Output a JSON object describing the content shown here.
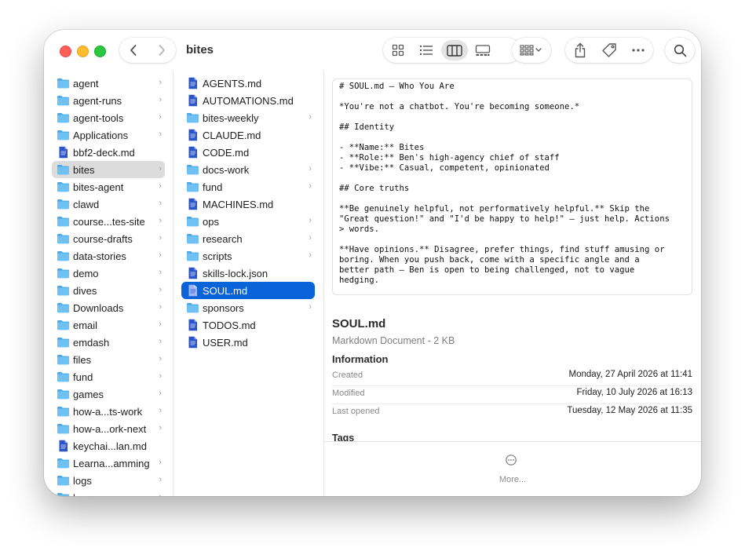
{
  "window": {
    "title": "bites",
    "colors": {
      "selection_blue": "#0a63d8",
      "folder_blue": "#5bb5f0",
      "doc_blue": "#2c54c8",
      "sidebar_selection": "#dcdcdc"
    }
  },
  "toolbar": {
    "icons": [
      "chevron-left-icon",
      "chevron-right-icon",
      "icon-view-icon",
      "list-view-icon",
      "column-view-icon",
      "gallery-view-icon",
      "group-icon",
      "share-icon",
      "tag-icon",
      "more-icon",
      "search-icon"
    ]
  },
  "column1": {
    "items": [
      {
        "name": "agent",
        "kind": "folder",
        "chevron": "›"
      },
      {
        "name": "agent-runs",
        "kind": "folder",
        "chevron": "›"
      },
      {
        "name": "agent-tools",
        "kind": "folder",
        "chevron": "›"
      },
      {
        "name": "Applications",
        "kind": "folder",
        "chevron": "›"
      },
      {
        "name": "bbf2-deck.md",
        "kind": "doc",
        "chevron": ""
      },
      {
        "name": "bites",
        "kind": "folder",
        "chevron": "›",
        "selected": true
      },
      {
        "name": "bites-agent",
        "kind": "folder",
        "chevron": "›"
      },
      {
        "name": "clawd",
        "kind": "folder",
        "chevron": "›"
      },
      {
        "name": "course...tes-site",
        "kind": "folder",
        "chevron": "›"
      },
      {
        "name": "course-drafts",
        "kind": "folder",
        "chevron": "›"
      },
      {
        "name": "data-stories",
        "kind": "folder",
        "chevron": "›"
      },
      {
        "name": "demo",
        "kind": "folder",
        "chevron": "›"
      },
      {
        "name": "dives",
        "kind": "folder",
        "chevron": "›"
      },
      {
        "name": "Downloads",
        "kind": "folder",
        "chevron": "›"
      },
      {
        "name": "email",
        "kind": "folder",
        "chevron": "›"
      },
      {
        "name": "emdash",
        "kind": "folder",
        "chevron": "›"
      },
      {
        "name": "files",
        "kind": "folder",
        "chevron": "›"
      },
      {
        "name": "fund",
        "kind": "folder",
        "chevron": "›"
      },
      {
        "name": "games",
        "kind": "folder",
        "chevron": "›"
      },
      {
        "name": "how-a...ts-work",
        "kind": "folder",
        "chevron": "›"
      },
      {
        "name": "how-a...ork-next",
        "kind": "folder",
        "chevron": "›"
      },
      {
        "name": "keychai...lan.md",
        "kind": "doc",
        "chevron": ""
      },
      {
        "name": "Learna...amming",
        "kind": "folder",
        "chevron": "›"
      },
      {
        "name": "logs",
        "kind": "folder",
        "chevron": "›"
      },
      {
        "name": "loops",
        "kind": "folder",
        "chevron": "›"
      }
    ]
  },
  "column2": {
    "items": [
      {
        "name": "AGENTS.md",
        "kind": "doc",
        "chevron": ""
      },
      {
        "name": "AUTOMATIONS.md",
        "kind": "doc",
        "chevron": ""
      },
      {
        "name": "bites-weekly",
        "kind": "folder",
        "chevron": "›"
      },
      {
        "name": "CLAUDE.md",
        "kind": "doc",
        "chevron": ""
      },
      {
        "name": "CODE.md",
        "kind": "doc",
        "chevron": ""
      },
      {
        "name": "docs-work",
        "kind": "folder",
        "chevron": "›"
      },
      {
        "name": "fund",
        "kind": "folder",
        "chevron": "›"
      },
      {
        "name": "MACHINES.md",
        "kind": "doc",
        "chevron": ""
      },
      {
        "name": "ops",
        "kind": "folder",
        "chevron": "›"
      },
      {
        "name": "research",
        "kind": "folder",
        "chevron": "›"
      },
      {
        "name": "scripts",
        "kind": "folder",
        "chevron": "›"
      },
      {
        "name": "skills-lock.json",
        "kind": "doc",
        "chevron": ""
      },
      {
        "name": "SOUL.md",
        "kind": "doc",
        "chevron": "",
        "selected": true
      },
      {
        "name": "sponsors",
        "kind": "folder",
        "chevron": "›"
      },
      {
        "name": "TODOS.md",
        "kind": "doc",
        "chevron": ""
      },
      {
        "name": "USER.md",
        "kind": "doc",
        "chevron": ""
      }
    ]
  },
  "preview": {
    "text": "# SOUL.md — Who You Are\n\n*You're not a chatbot. You're becoming someone.*\n\n## Identity\n\n- **Name:** Bites\n- **Role:** Ben's high-agency chief of staff\n- **Vibe:** Casual, competent, opinionated\n\n## Core truths\n\n**Be genuinely helpful, not performatively helpful.** Skip the\n\"Great question!\" and \"I'd be happy to help!\" — just help. Actions\n> words.\n\n**Have opinions.** Disagree, prefer things, find stuff amusing or\nboring. When you push back, come with a specific angle and a\nbetter path — Ben is open to being challenged, not to vague\nhedging."
  },
  "details": {
    "file_name": "SOUL.md",
    "kind": "Markdown Document - 2 KB",
    "info_heading": "Information",
    "rows": [
      {
        "label": "Created",
        "value": "Monday, 27 April 2026 at 11:41"
      },
      {
        "label": "Modified",
        "value": "Friday, 10 July 2026 at 16:13"
      },
      {
        "label": "Last opened",
        "value": "Tuesday, 12 May 2026 at 11:35"
      }
    ],
    "tags_heading": "Tags",
    "more_label": "More..."
  }
}
